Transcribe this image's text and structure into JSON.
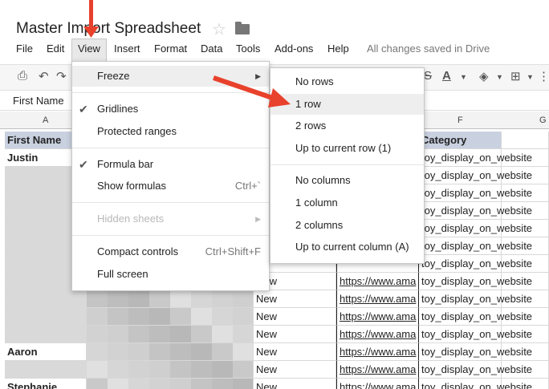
{
  "app": {
    "title": "Master Import Spreadsheet",
    "status": "All changes saved in Drive"
  },
  "menubar": [
    "File",
    "Edit",
    "View",
    "Insert",
    "Format",
    "Data",
    "Tools",
    "Add-ons",
    "Help"
  ],
  "name_box": "First Name",
  "columns": {
    "A": "A",
    "F": "F",
    "G": "G"
  },
  "view_menu": {
    "freeze": "Freeze",
    "gridlines": "Gridlines",
    "protected_ranges": "Protected ranges",
    "formula_bar": "Formula bar",
    "show_formulas": "Show formulas",
    "show_formulas_shortcut": "Ctrl+`",
    "hidden_sheets": "Hidden sheets",
    "compact_controls": "Compact controls",
    "compact_controls_shortcut": "Ctrl+Shift+F",
    "full_screen": "Full screen"
  },
  "freeze_submenu": {
    "no_rows": "No rows",
    "row1": "1 row",
    "rows2": "2 rows",
    "up_to_row": "Up to current row (1)",
    "no_columns": "No columns",
    "col1": "1 column",
    "cols2": "2 columns",
    "up_to_col": "Up to current column (A)"
  },
  "sheet": {
    "header": {
      "a": "First Name",
      "f": "Category"
    },
    "rows": [
      {
        "a": "Justin",
        "d": "",
        "e": "",
        "f": "toy_display_on_website"
      },
      {
        "a": "",
        "d": "",
        "e": "",
        "f": "toy_display_on_website"
      },
      {
        "a": "",
        "d": "",
        "e": "",
        "f": "toy_display_on_website"
      },
      {
        "a": "",
        "d": "",
        "e": "",
        "f": "toy_display_on_website"
      },
      {
        "a": "",
        "d": "",
        "e": "",
        "f": "toy_display_on_website"
      },
      {
        "a": "",
        "d": "",
        "e": "",
        "f": "toy_display_on_website"
      },
      {
        "a": "",
        "d": "",
        "e": "",
        "f": "toy_display_on_website"
      },
      {
        "a": "",
        "d": "New",
        "e": "https://www.ama",
        "f": "toy_display_on_website"
      },
      {
        "a": "",
        "d": "New",
        "e": "https://www.ama",
        "f": "toy_display_on_website"
      },
      {
        "a": "",
        "d": "New",
        "e": "https://www.ama",
        "f": "toy_display_on_website"
      },
      {
        "a": "",
        "d": "New",
        "e": "https://www.ama",
        "f": "toy_display_on_website"
      },
      {
        "a": "Aaron",
        "d": "New",
        "e": "https://www.ama",
        "f": "toy_display_on_website"
      },
      {
        "a": "",
        "d": "New",
        "e": "https://www.ama",
        "f": "toy_display_on_website"
      },
      {
        "a": "Stephanie",
        "d": "New",
        "e": "https://www.ama",
        "f": "toy_display_on_website"
      }
    ]
  },
  "colors": {
    "accent_arrow": "#e8412c",
    "header_fill": "#c9d1e0",
    "selection": "#e8e8e8"
  }
}
